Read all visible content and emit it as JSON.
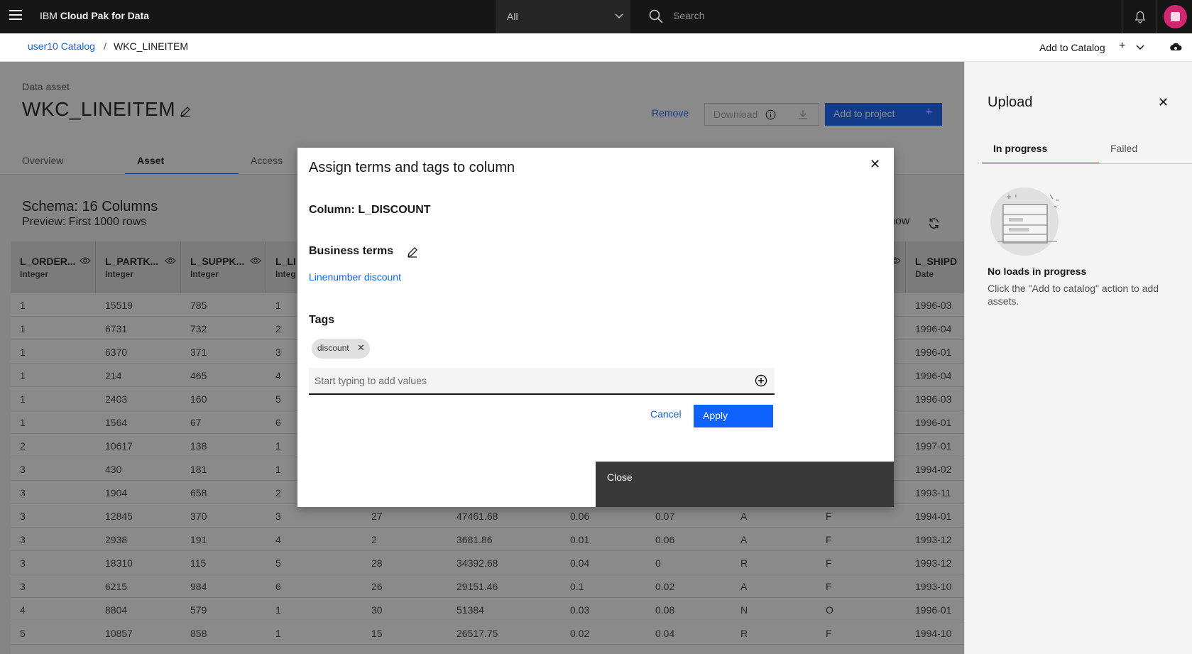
{
  "topbar": {
    "brand_prefix": "IBM",
    "brand_name": "Cloud Pak for Data",
    "scope_value": "All",
    "search_placeholder": "Search"
  },
  "breadcrumb": {
    "parent": "user10 Catalog",
    "separator": "/",
    "current": "WKC_LINEITEM",
    "add_to_catalog": "Add to Catalog",
    "add_plus": "+"
  },
  "asset": {
    "type_label": "Data asset",
    "name": "WKC_LINEITEM",
    "remove": "Remove",
    "download": "Download",
    "add_to_project": "Add to project",
    "add_plus": "+"
  },
  "tabs": [
    "Overview",
    "Asset",
    "Access"
  ],
  "schema": {
    "title": "Schema:  16 Columns",
    "preview": "Preview: First 1000 rows",
    "show_fragment": "how"
  },
  "table": {
    "columns": [
      {
        "name": "L_ORDER...",
        "type": "Integer",
        "eye": true
      },
      {
        "name": "L_PARTK...",
        "type": "Integer",
        "eye": true
      },
      {
        "name": "L_SUPPK...",
        "type": "Integer",
        "eye": true
      },
      {
        "name": "L_LI",
        "type": "Integ",
        "eye": false
      },
      {
        "name": "",
        "type": "",
        "eye": false
      },
      {
        "name": "",
        "type": "",
        "eye": false
      },
      {
        "name": "",
        "type": "",
        "eye": false
      },
      {
        "name": "",
        "type": "",
        "eye": false
      },
      {
        "name": "",
        "type": "",
        "eye": false
      },
      {
        "name": "",
        "type": "",
        "eye": true
      },
      {
        "name": "L_SHIPD",
        "type": "Date",
        "eye": false
      }
    ],
    "rows": [
      [
        "1",
        "15519",
        "785",
        "1",
        "",
        "",
        "",
        "",
        "",
        "",
        "1996-03"
      ],
      [
        "1",
        "6731",
        "732",
        "2",
        "",
        "",
        "",
        "",
        "",
        "",
        "1996-04"
      ],
      [
        "1",
        "6370",
        "371",
        "3",
        "",
        "",
        "",
        "",
        "",
        "",
        "1996-01"
      ],
      [
        "1",
        "214",
        "465",
        "4",
        "",
        "",
        "",
        "",
        "",
        "",
        "1996-04"
      ],
      [
        "1",
        "2403",
        "160",
        "5",
        "",
        "",
        "",
        "",
        "",
        "",
        "1996-03"
      ],
      [
        "1",
        "1564",
        "67",
        "6",
        "",
        "",
        "",
        "",
        "",
        "",
        "1996-01"
      ],
      [
        "2",
        "10617",
        "138",
        "1",
        "",
        "",
        "",
        "",
        "",
        "",
        "1997-01"
      ],
      [
        "3",
        "430",
        "181",
        "1",
        "",
        "",
        "",
        "",
        "",
        "",
        "1994-02"
      ],
      [
        "3",
        "1904",
        "658",
        "2",
        "",
        "",
        "",
        "",
        "",
        "",
        "1993-11"
      ],
      [
        "3",
        "12845",
        "370",
        "3",
        "27",
        "47461.68",
        "0.06",
        "0.07",
        "A",
        "F",
        "1994-01"
      ],
      [
        "3",
        "2938",
        "191",
        "4",
        "2",
        "3681.86",
        "0.01",
        "0.06",
        "A",
        "F",
        "1993-12"
      ],
      [
        "3",
        "18310",
        "115",
        "5",
        "28",
        "34392.68",
        "0.04",
        "0",
        "R",
        "F",
        "1993-12"
      ],
      [
        "3",
        "6215",
        "984",
        "6",
        "26",
        "29151.46",
        "0.1",
        "0.02",
        "A",
        "F",
        "1993-10"
      ],
      [
        "4",
        "8804",
        "579",
        "1",
        "30",
        "51384",
        "0.03",
        "0.08",
        "N",
        "O",
        "1996-01"
      ],
      [
        "5",
        "10857",
        "858",
        "1",
        "15",
        "26517.75",
        "0.02",
        "0.04",
        "R",
        "F",
        "1994-10"
      ]
    ]
  },
  "upload": {
    "title": "Upload",
    "tab_in_progress": "In progress",
    "tab_failed": "Failed",
    "empty_title": "No loads in progress",
    "empty_desc": "Click the \"Add to catalog\" action to add assets."
  },
  "modal": {
    "title": "Assign terms and tags to column",
    "column_label": "Column: L_DISCOUNT",
    "business_terms_label": "Business terms",
    "business_term_link": "Linenumber discount",
    "tags_label": "Tags",
    "tag_chip": "discount",
    "tag_input_placeholder": "Start typing to add values",
    "cancel": "Cancel",
    "apply": "Apply",
    "close_bar": "Close"
  }
}
